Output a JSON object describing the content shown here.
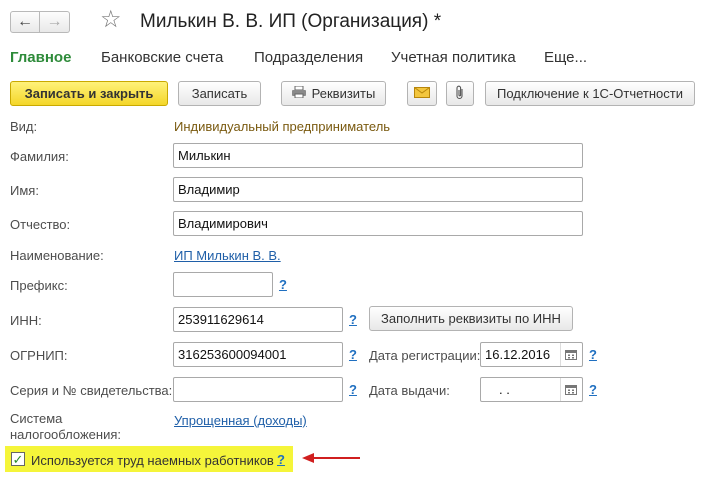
{
  "window": {
    "title": "Милькин В. В. ИП (Организация) *",
    "back_icon": "arrow-left",
    "forward_icon": "arrow-right"
  },
  "tabs": [
    "Главное",
    "Банковские счета",
    "Подразделения",
    "Учетная политика",
    "Еще..."
  ],
  "toolbar": {
    "save_close": "Записать и закрыть",
    "save": "Записать",
    "requisites": "Реквизиты",
    "connect": "Подключение к 1С-Отчетности"
  },
  "form": {
    "kind_label": "Вид:",
    "kind_value": "Индивидуальный предприниматель",
    "surname_label": "Фамилия:",
    "surname_value": "Милькин",
    "name_label": "Имя:",
    "name_value": "Владимир",
    "patronymic_label": "Отчество:",
    "patronymic_value": "Владимирович",
    "title_label": "Наименование:",
    "title_value": "ИП Милькин В. В.",
    "prefix_label": "Префикс:",
    "prefix_value": "",
    "inn_label": "ИНН:",
    "inn_value": "253911629614",
    "fill_by_inn": "Заполнить реквизиты по ИНН",
    "ogrnip_label": "ОГРНИП:",
    "ogrnip_value": "316253600094001",
    "reg_date_label": "Дата регистрации:",
    "reg_date_value": "16.12.2016",
    "cert_label": "Серия и № свидетельства:",
    "cert_value": "",
    "issue_date_label": "Дата выдачи:",
    "issue_date_value": " .  .",
    "tax_label_1": "Система",
    "tax_label_2": "налогообложения:",
    "tax_value": "Упрощенная (доходы)",
    "employees_label": "Используется труд наемных работников",
    "employees_checked": true,
    "help": "?"
  },
  "colors": {
    "primary_button": "#f4d629",
    "active_tab": "#2e8b3a",
    "link": "#1f5fa8",
    "highlight": "#f5f53a",
    "arrow": "#d01f1f"
  }
}
